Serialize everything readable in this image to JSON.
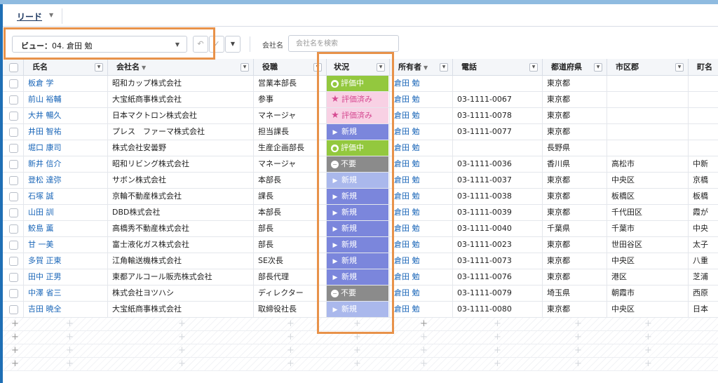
{
  "tab": {
    "label": "リード"
  },
  "view": {
    "prefix": "ビュー：",
    "name": "04. 倉田 勉"
  },
  "search": {
    "label": "会社名",
    "placeholder": "会社名を検索"
  },
  "columns": [
    "氏名",
    "会社名",
    "役職",
    "状況",
    "所有者",
    "電話",
    "都道府県",
    "市区郡",
    "町名"
  ],
  "status_labels": {
    "eval": "評価中",
    "done": "評価済み",
    "new": "新規",
    "no": "不要"
  },
  "rows": [
    {
      "name": "板倉 学",
      "company": "昭和カップ株式会社",
      "title": "営業本部長",
      "status": "eval",
      "owner": "倉田 勉",
      "phone": "",
      "pref": "東京都",
      "city": "",
      "town": ""
    },
    {
      "name": "前山 裕輔",
      "company": "大宝紙商事株式会社",
      "title": "参事",
      "status": "done",
      "owner": "倉田 勉",
      "phone": "03-1111-0067",
      "pref": "東京都",
      "city": "",
      "town": ""
    },
    {
      "name": "大井 暢久",
      "company": "日本マクトロン株式会社",
      "title": "マネージャ",
      "status": "done",
      "owner": "倉田 勉",
      "phone": "03-1111-0078",
      "pref": "東京都",
      "city": "",
      "town": ""
    },
    {
      "name": "井田 智祐",
      "company": "プレス　ファーマ株式会社",
      "title": "担当課長",
      "status": "new",
      "owner": "倉田 勉",
      "phone": "03-1111-0077",
      "pref": "東京都",
      "city": "",
      "town": ""
    },
    {
      "name": "堀口 康司",
      "company": "株式会社安曇野",
      "title": "生産企画部長",
      "status": "eval",
      "owner": "倉田 勉",
      "phone": "",
      "pref": "長野県",
      "city": "",
      "town": ""
    },
    {
      "name": "新井 信介",
      "company": "昭和リビング株式会社",
      "title": "マネージャ",
      "status": "no",
      "owner": "倉田 勉",
      "phone": "03-1111-0036",
      "pref": "香川県",
      "city": "高松市",
      "town": "中新"
    },
    {
      "name": "登松 達弥",
      "company": "サボン株式会社",
      "title": "本部長",
      "status": "new2",
      "owner": "倉田 勉",
      "phone": "03-1111-0037",
      "pref": "東京都",
      "city": "中央区",
      "town": "京橋"
    },
    {
      "name": "石塚 誠",
      "company": "京輪不動産株式会社",
      "title": "課長",
      "status": "new",
      "owner": "倉田 勉",
      "phone": "03-1111-0038",
      "pref": "東京都",
      "city": "板橋区",
      "town": "板橋"
    },
    {
      "name": "山田 訓",
      "company": "DBD株式会社",
      "title": "本部長",
      "status": "new",
      "owner": "倉田 勉",
      "phone": "03-1111-0039",
      "pref": "東京都",
      "city": "千代田区",
      "town": "霞が"
    },
    {
      "name": "鮫島 薫",
      "company": "高橋秀不動産株式会社",
      "title": "部長",
      "status": "new",
      "owner": "倉田 勉",
      "phone": "03-1111-0040",
      "pref": "千葉県",
      "city": "千葉市",
      "town": "中央"
    },
    {
      "name": "甘 一美",
      "company": "富士液化ガス株式会社",
      "title": "部長",
      "status": "new",
      "owner": "倉田 勉",
      "phone": "03-1111-0023",
      "pref": "東京都",
      "city": "世田谷区",
      "town": "太子"
    },
    {
      "name": "多賀 正東",
      "company": "江角輸送機株式会社",
      "title": "SE次長",
      "status": "new",
      "owner": "倉田 勉",
      "phone": "03-1111-0073",
      "pref": "東京都",
      "city": "中央区",
      "town": "八重"
    },
    {
      "name": "田中 正男",
      "company": "東都アルコール販売株式会社",
      "title": "部長代理",
      "status": "new",
      "owner": "倉田 勉",
      "phone": "03-1111-0076",
      "pref": "東京都",
      "city": "港区",
      "town": "芝浦"
    },
    {
      "name": "中澤 省三",
      "company": "株式会社ヨツハシ",
      "title": "ディレクター",
      "status": "no",
      "owner": "倉田 勉",
      "phone": "03-1111-0079",
      "pref": "埼玉県",
      "city": "朝霞市",
      "town": "西原"
    },
    {
      "name": "吉田 暁全",
      "company": "大宝紙商事株式会社",
      "title": "取締役社長",
      "status": "new2",
      "owner": "倉田 勉",
      "phone": "03-1111-0080",
      "pref": "東京都",
      "city": "中央区",
      "town": "日本"
    }
  ],
  "colors": {
    "highlight": "#e8924a",
    "link": "#1a66b8",
    "eval": "#93c83e",
    "done": "#f8d1e4",
    "new": "#7b86dc",
    "no": "#8b8b8b"
  }
}
